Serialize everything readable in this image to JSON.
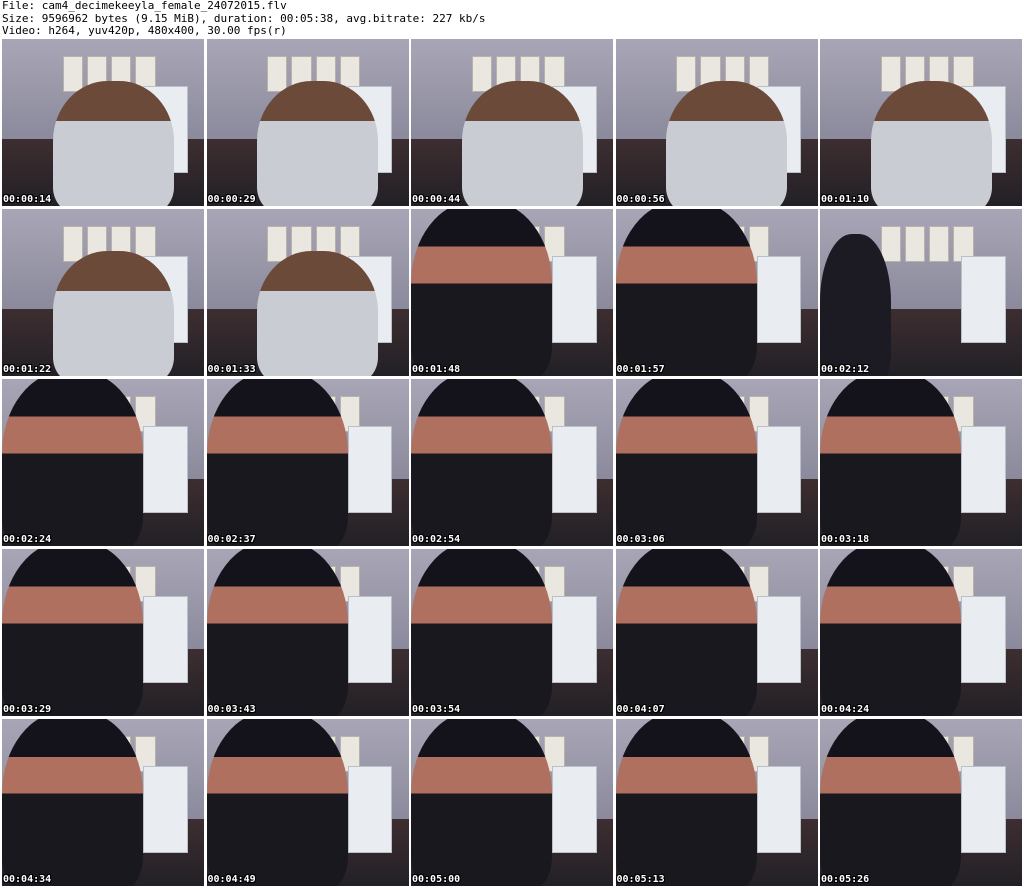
{
  "header": {
    "file_line": "File: cam4_decimekeeyla_female_24072015.flv",
    "size_line": "Size: 9596962 bytes (9.15 MiB), duration: 00:05:38, avg.bitrate: 227 kb/s",
    "video_line": "Video: h264, yuv420p, 480x400, 30.00 fps(r)"
  },
  "thumbnails": [
    {
      "time": "00:00:14",
      "scene": "hoodie"
    },
    {
      "time": "00:00:29",
      "scene": "hoodie"
    },
    {
      "time": "00:00:44",
      "scene": "hoodie"
    },
    {
      "time": "00:00:56",
      "scene": "hoodie"
    },
    {
      "time": "00:01:10",
      "scene": "hoodie"
    },
    {
      "time": "00:01:22",
      "scene": "hoodie"
    },
    {
      "time": "00:01:33",
      "scene": "hoodie"
    },
    {
      "time": "00:01:48",
      "scene": "dark"
    },
    {
      "time": "00:01:57",
      "scene": "dark"
    },
    {
      "time": "00:02:12",
      "scene": "kitchen"
    },
    {
      "time": "00:02:24",
      "scene": "dark"
    },
    {
      "time": "00:02:37",
      "scene": "dark"
    },
    {
      "time": "00:02:54",
      "scene": "dark"
    },
    {
      "time": "00:03:06",
      "scene": "dark"
    },
    {
      "time": "00:03:18",
      "scene": "dark"
    },
    {
      "time": "00:03:29",
      "scene": "dark"
    },
    {
      "time": "00:03:43",
      "scene": "dark"
    },
    {
      "time": "00:03:54",
      "scene": "dark"
    },
    {
      "time": "00:04:07",
      "scene": "dark"
    },
    {
      "time": "00:04:24",
      "scene": "dark"
    },
    {
      "time": "00:04:34",
      "scene": "dark"
    },
    {
      "time": "00:04:49",
      "scene": "dark"
    },
    {
      "time": "00:05:00",
      "scene": "dark"
    },
    {
      "time": "00:05:13",
      "scene": "dark"
    },
    {
      "time": "00:05:26",
      "scene": "dark"
    }
  ]
}
